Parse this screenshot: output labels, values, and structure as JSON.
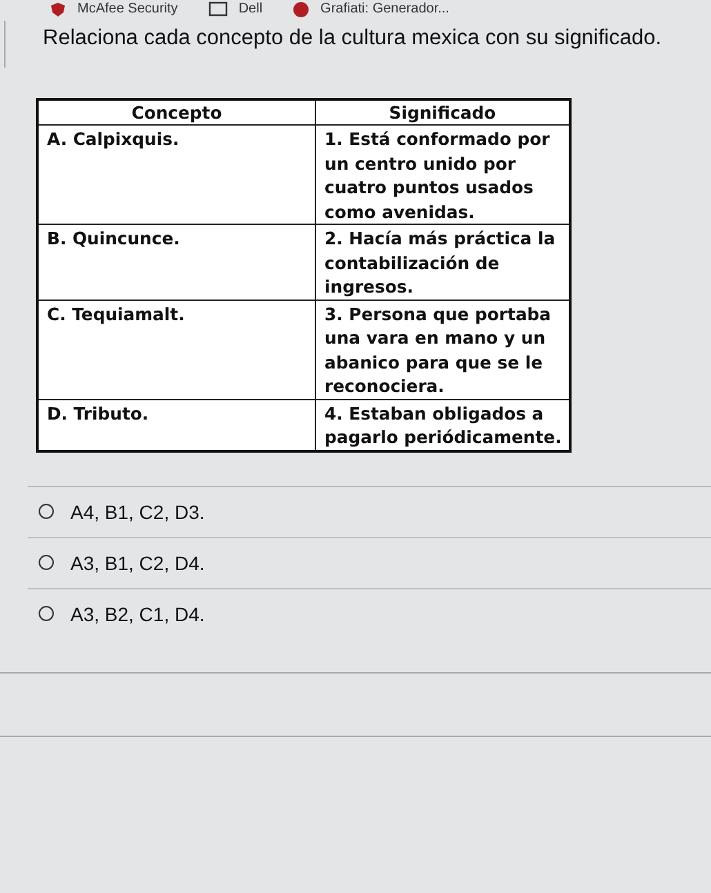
{
  "bookmarks": [
    {
      "label": "McAfee Security",
      "kind": "shield"
    },
    {
      "label": "Dell",
      "kind": "folder"
    },
    {
      "label": "Grafiati: Generador...",
      "kind": "circle"
    }
  ],
  "question": "Relaciona cada concepto de la cultura mexica con su significado.",
  "table": {
    "columns": [
      "Concepto",
      "Significado"
    ],
    "rows": [
      [
        "A. Calpixquis.",
        "1. Está conformado por un centro unido por cuatro puntos usados como avenidas."
      ],
      [
        "B. Quincunce.",
        "2. Hacía más práctica la contabilización de ingresos."
      ],
      [
        "C. Tequiamalt.",
        "3. Persona que portaba una vara en mano y un abanico para que se le reconociera."
      ],
      [
        "D. Tributo.",
        "4. Estaban obligados a pagarlo periódicamente."
      ]
    ]
  },
  "options": [
    {
      "label": "A4, B1, C2, D3.",
      "selected": false
    },
    {
      "label": "A3, B1, C2, D4.",
      "selected": false
    },
    {
      "label": "A3, B2, C1, D4.",
      "selected": false
    }
  ]
}
